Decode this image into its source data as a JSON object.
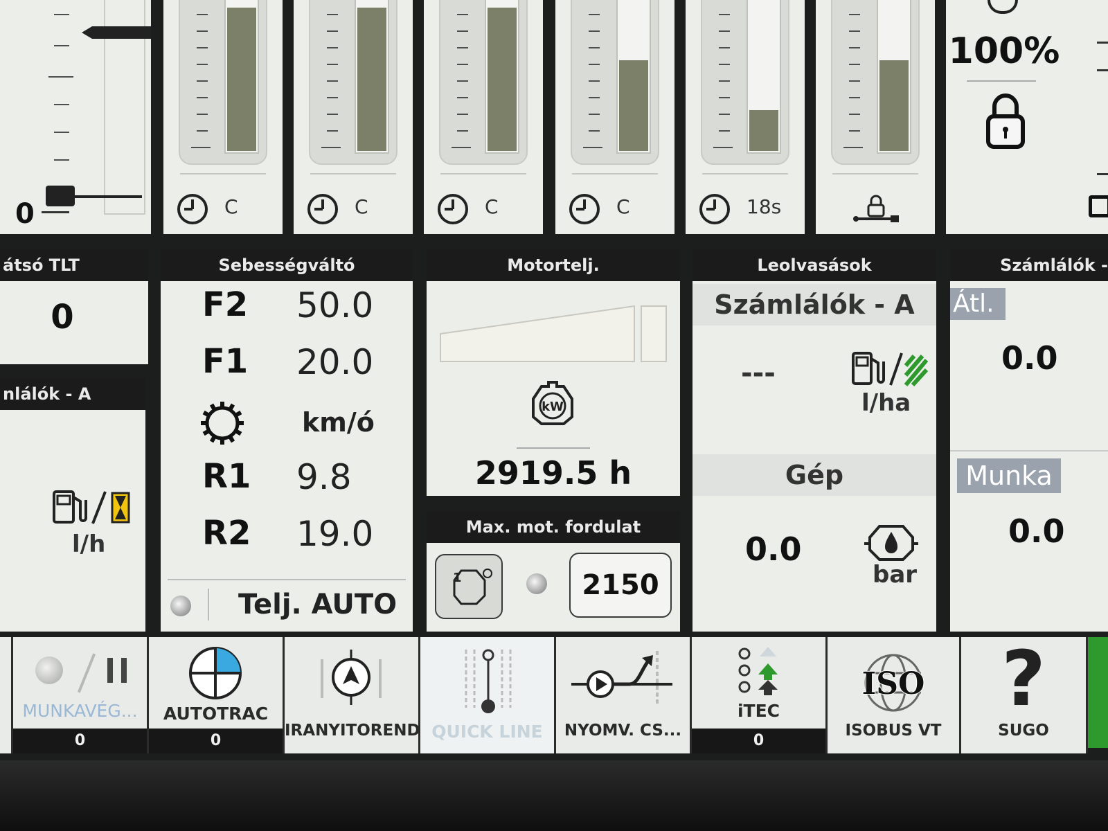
{
  "sliders": {
    "left_scale_zero": "0",
    "columns": [
      {
        "label": "C",
        "level": 0.95
      },
      {
        "label": "C",
        "level": 0.95
      },
      {
        "label": "C",
        "level": 0.95
      },
      {
        "label": "C",
        "level": 0.6
      },
      {
        "label": "18s",
        "level": 0.27
      },
      {
        "label": "",
        "level": 0.6
      }
    ],
    "right_percent": "100%"
  },
  "rear_pto": {
    "header": "átsó TLT",
    "value": "0"
  },
  "counters_left": {
    "header": "nlálók - A",
    "unit": "l/h"
  },
  "transmission": {
    "header": "Sebességváltó",
    "rows": [
      {
        "gear": "F2",
        "speed": "50.0"
      },
      {
        "gear": "F1",
        "speed": "20.0"
      },
      {
        "gear": "",
        "speed": "km/ó"
      },
      {
        "gear": "R1",
        "speed": "9.8"
      },
      {
        "gear": "R2",
        "speed": "19.0"
      }
    ],
    "mode": "Telj. AUTO"
  },
  "engine_power": {
    "header": "Motortelj.",
    "hours": "2919.5 h",
    "icon_label": "kW"
  },
  "max_rpm": {
    "header": "Max. mot. fordulat",
    "value": "2150",
    "icon_num": "1"
  },
  "readings": {
    "header": "Leolvasások",
    "group_a": "Számlálók - A",
    "fuel_value": "---",
    "fuel_unit": "l/ha",
    "group_b": "Gép",
    "pressure_value": "0.0",
    "pressure_unit": "bar"
  },
  "counters_right": {
    "header": "Számlálók -",
    "tab_avg": "Átl.",
    "avg_value": "0.0",
    "tab_work": "Munka",
    "work_value": "0.0"
  },
  "nav": [
    {
      "label": "MUNKAVÉG...",
      "count": "0"
    },
    {
      "label": "AUTOTRAC",
      "count": "0"
    },
    {
      "label": "IRANYITOREND",
      "count": ""
    },
    {
      "label": "QUICK LINE",
      "count": ""
    },
    {
      "label": "NYOMV. CS...",
      "count": ""
    },
    {
      "label": "iTEC",
      "count": "0"
    },
    {
      "label": "ISOBUS VT",
      "count": ""
    },
    {
      "label": "SUGO",
      "count": ""
    }
  ],
  "colors": {
    "header_bg": "#1b1b1b",
    "panel_bg": "#eceeea",
    "bar_fill": "#7d8068",
    "accent_green": "#2e9a2e",
    "autotrac_blue": "#39a9e0",
    "fuel_yellow": "#f1c40f"
  }
}
